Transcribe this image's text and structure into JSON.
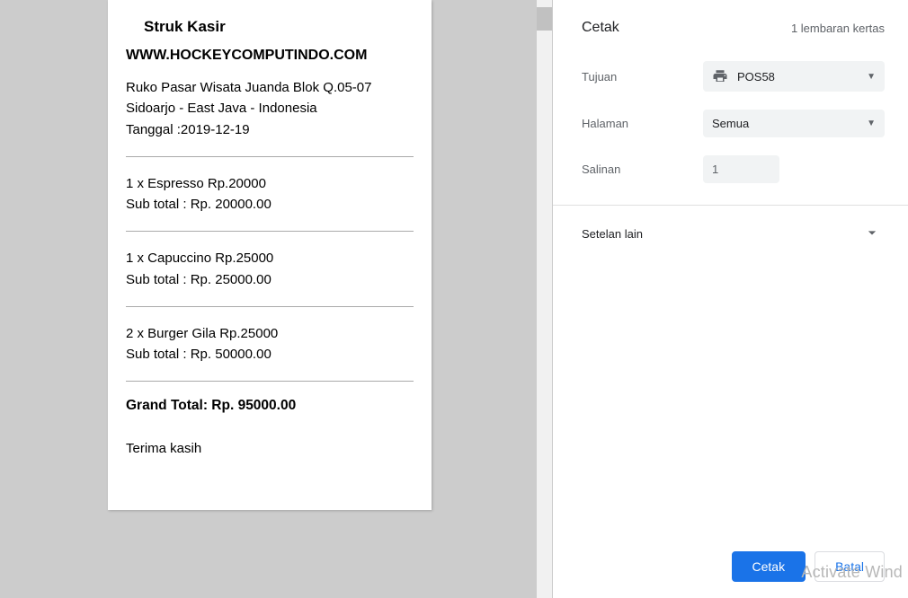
{
  "receipt": {
    "title": "Struk Kasir",
    "url": "WWW.HOCKEYCOMPUTINDO.COM",
    "address_line1": "Ruko Pasar Wisata Juanda Blok Q.05-07",
    "address_line2": "Sidoarjo - East Java - Indonesia",
    "date_line": "Tanggal :2019-12-19",
    "items": [
      {
        "line1": "1 x Espresso Rp.20000",
        "line2": "Sub total : Rp. 20000.00"
      },
      {
        "line1": "1 x Capuccino Rp.25000",
        "line2": "Sub total : Rp. 25000.00"
      },
      {
        "line1": "2 x Burger Gila Rp.25000",
        "line2": "Sub total : Rp. 50000.00"
      }
    ],
    "grand_total": "Grand Total: Rp. 95000.00",
    "thanks": "Terima kasih"
  },
  "panel": {
    "header_title": "Cetak",
    "header_sheet": "1 lembaran kertas",
    "destination_label": "Tujuan",
    "destination_value": "POS58",
    "pages_label": "Halaman",
    "pages_value": "Semua",
    "copies_label": "Salinan",
    "copies_value": "1",
    "more_settings": "Setelan lain",
    "print_button": "Cetak",
    "cancel_button": "Batal"
  },
  "watermark": "Activate Wind"
}
